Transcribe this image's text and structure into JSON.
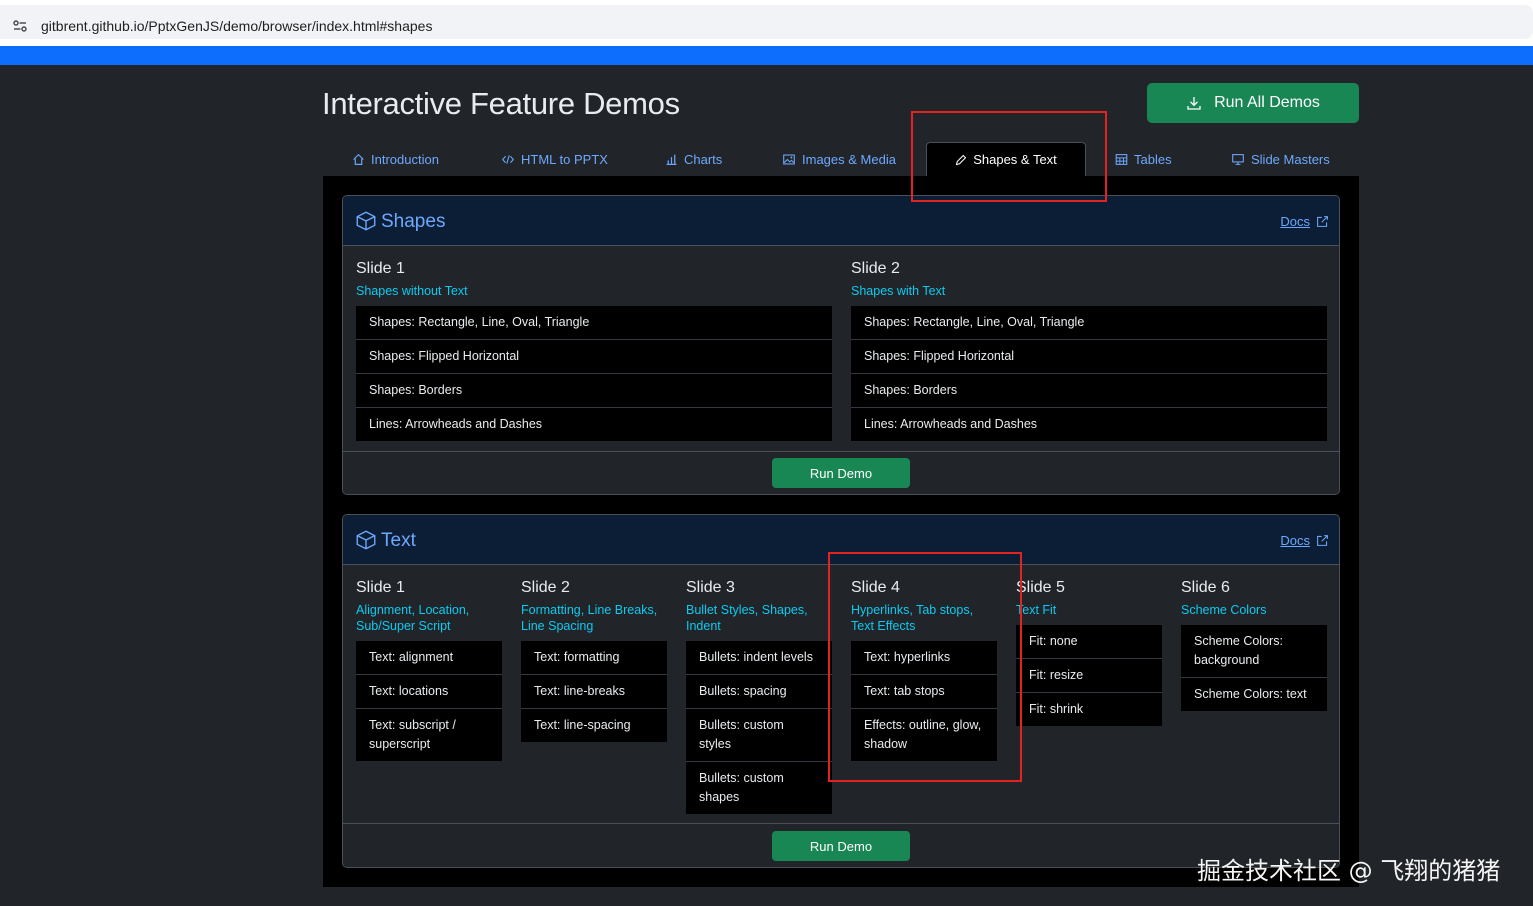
{
  "browser": {
    "url": "gitbrent.github.io/PptxGenJS/demo/browser/index.html#shapes"
  },
  "page": {
    "title": "Interactive Feature Demos",
    "run_all_label": "Run All Demos"
  },
  "tabs": [
    {
      "label": "Introduction",
      "icon": "home-icon"
    },
    {
      "label": "HTML to PPTX",
      "icon": "code-icon"
    },
    {
      "label": "Charts",
      "icon": "bar-chart-icon"
    },
    {
      "label": "Images & Media",
      "icon": "image-icon"
    },
    {
      "label": "Shapes & Text",
      "icon": "pencil-icon",
      "active": true
    },
    {
      "label": "Tables",
      "icon": "table-icon"
    },
    {
      "label": "Slide Masters",
      "icon": "easel-icon"
    }
  ],
  "shapes_card": {
    "title": "Shapes",
    "docs_label": "Docs",
    "run_label": "Run Demo",
    "slides": [
      {
        "title": "Slide 1",
        "subtitle": "Shapes without Text",
        "items": [
          "Shapes: Rectangle, Line, Oval, Triangle",
          "Shapes: Flipped Horizontal",
          "Shapes: Borders",
          "Lines: Arrowheads and Dashes"
        ]
      },
      {
        "title": "Slide 2",
        "subtitle": "Shapes with Text",
        "items": [
          "Shapes: Rectangle, Line, Oval, Triangle",
          "Shapes: Flipped Horizontal",
          "Shapes: Borders",
          "Lines: Arrowheads and Dashes"
        ]
      }
    ]
  },
  "text_card": {
    "title": "Text",
    "docs_label": "Docs",
    "run_label": "Run Demo",
    "slides": [
      {
        "title": "Slide 1",
        "subtitle": "Alignment, Location, Sub/Super Script",
        "items": [
          "Text: alignment",
          "Text: locations",
          "Text: subscript / superscript"
        ]
      },
      {
        "title": "Slide 2",
        "subtitle": "Formatting, Line Breaks, Line Spacing",
        "items": [
          "Text: formatting",
          "Text: line-breaks",
          "Text: line-spacing"
        ]
      },
      {
        "title": "Slide 3",
        "subtitle": "Bullet Styles, Shapes, Indent",
        "items": [
          "Bullets: indent levels",
          "Bullets: spacing",
          "Bullets: custom styles",
          "Bullets: custom shapes"
        ]
      },
      {
        "title": "Slide 4",
        "subtitle": "Hyperlinks, Tab stops, Text Effects",
        "items": [
          "Text: hyperlinks",
          "Text: tab stops",
          "Effects: outline, glow, shadow"
        ]
      },
      {
        "title": "Slide 5",
        "subtitle": "Text Fit",
        "items": [
          "Fit: none",
          "Fit: resize",
          "Fit: shrink"
        ]
      },
      {
        "title": "Slide 6",
        "subtitle": "Scheme Colors",
        "items": [
          "Scheme Colors: background",
          "Scheme Colors: text"
        ]
      }
    ]
  },
  "watermark": "掘金技术社区 @ 飞翔的猪猪",
  "colors": {
    "accent": "#6ea8fe",
    "success": "#198754",
    "cyan": "#0dcaf0",
    "highlight": "#e32222"
  }
}
